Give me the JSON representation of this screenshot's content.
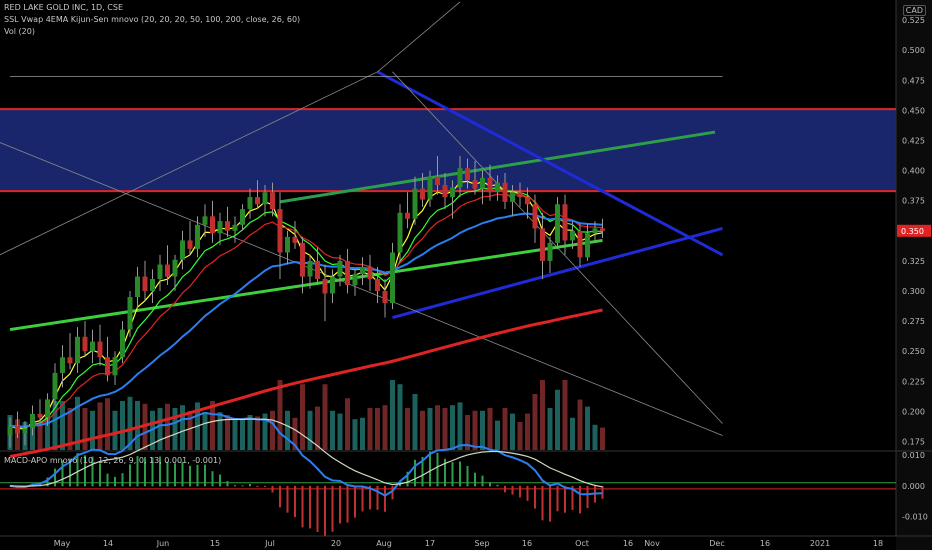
{
  "legend": {
    "line1": "RED LAKE GOLD INC, 1D, CSE",
    "line2": "SSL Vwap 4EMA Kijun-Sen mnovo (20, 20, 20, 50, 100, 200, close, 26, 60)",
    "line3": "Vol (20)",
    "macd": "MACD-APO mnovo (10, 12, 26, 9, 0, 13, 0.001, -0.001)"
  },
  "currency": "CAD",
  "chart_data": {
    "type": "candlestick",
    "price_axis": {
      "ticks": [
        "0.525",
        "0.500",
        "0.475",
        "0.450",
        "0.425",
        "0.400",
        "0.375",
        "0.350",
        "0.325",
        "0.300",
        "0.275",
        "0.250",
        "0.225",
        "0.200",
        "0.175"
      ],
      "ylim": [
        0.168,
        0.535
      ],
      "last_price": "0.350",
      "last_price_color": "#e02424"
    },
    "macd_axis": {
      "ticks": [
        "0.010",
        "0.000",
        "-0.010"
      ],
      "ylim": [
        -0.015,
        0.011
      ]
    },
    "x_ticks": [
      "May",
      "14",
      "Jun",
      "15",
      "Jul",
      "20",
      "Aug",
      "17",
      "Sep",
      "16",
      "Oct",
      "16",
      "Nov",
      "Dec",
      "16",
      "2021",
      "18"
    ],
    "zones": [
      {
        "name": "supply-zone",
        "from": 0.383,
        "to": 0.451,
        "color": "#1c2a78"
      }
    ],
    "red_levels": [
      0.451,
      0.383
    ],
    "candles": [
      {
        "o": 0.18,
        "h": 0.195,
        "l": 0.17,
        "c": 0.188
      },
      {
        "o": 0.188,
        "h": 0.2,
        "l": 0.178,
        "c": 0.182
      },
      {
        "o": 0.182,
        "h": 0.192,
        "l": 0.172,
        "c": 0.186
      },
      {
        "o": 0.186,
        "h": 0.205,
        "l": 0.18,
        "c": 0.198
      },
      {
        "o": 0.198,
        "h": 0.21,
        "l": 0.19,
        "c": 0.195
      },
      {
        "o": 0.195,
        "h": 0.215,
        "l": 0.188,
        "c": 0.21
      },
      {
        "o": 0.21,
        "h": 0.24,
        "l": 0.205,
        "c": 0.232
      },
      {
        "o": 0.232,
        "h": 0.255,
        "l": 0.22,
        "c": 0.245
      },
      {
        "o": 0.245,
        "h": 0.265,
        "l": 0.235,
        "c": 0.24
      },
      {
        "o": 0.24,
        "h": 0.27,
        "l": 0.232,
        "c": 0.262
      },
      {
        "o": 0.262,
        "h": 0.275,
        "l": 0.245,
        "c": 0.25
      },
      {
        "o": 0.25,
        "h": 0.268,
        "l": 0.24,
        "c": 0.258
      },
      {
        "o": 0.258,
        "h": 0.272,
        "l": 0.238,
        "c": 0.245
      },
      {
        "o": 0.245,
        "h": 0.262,
        "l": 0.225,
        "c": 0.23
      },
      {
        "o": 0.23,
        "h": 0.25,
        "l": 0.222,
        "c": 0.245
      },
      {
        "o": 0.245,
        "h": 0.275,
        "l": 0.24,
        "c": 0.268
      },
      {
        "o": 0.268,
        "h": 0.3,
        "l": 0.262,
        "c": 0.295
      },
      {
        "o": 0.295,
        "h": 0.32,
        "l": 0.285,
        "c": 0.312
      },
      {
        "o": 0.312,
        "h": 0.325,
        "l": 0.292,
        "c": 0.3
      },
      {
        "o": 0.3,
        "h": 0.318,
        "l": 0.29,
        "c": 0.31
      },
      {
        "o": 0.31,
        "h": 0.33,
        "l": 0.3,
        "c": 0.322
      },
      {
        "o": 0.322,
        "h": 0.338,
        "l": 0.305,
        "c": 0.312
      },
      {
        "o": 0.312,
        "h": 0.33,
        "l": 0.3,
        "c": 0.326
      },
      {
        "o": 0.326,
        "h": 0.35,
        "l": 0.318,
        "c": 0.342
      },
      {
        "o": 0.342,
        "h": 0.358,
        "l": 0.33,
        "c": 0.335
      },
      {
        "o": 0.335,
        "h": 0.362,
        "l": 0.328,
        "c": 0.355
      },
      {
        "o": 0.355,
        "h": 0.372,
        "l": 0.345,
        "c": 0.362
      },
      {
        "o": 0.362,
        "h": 0.375,
        "l": 0.34,
        "c": 0.348
      },
      {
        "o": 0.348,
        "h": 0.365,
        "l": 0.338,
        "c": 0.358
      },
      {
        "o": 0.358,
        "h": 0.37,
        "l": 0.345,
        "c": 0.35
      },
      {
        "o": 0.35,
        "h": 0.362,
        "l": 0.34,
        "c": 0.355
      },
      {
        "o": 0.355,
        "h": 0.372,
        "l": 0.35,
        "c": 0.368
      },
      {
        "o": 0.368,
        "h": 0.385,
        "l": 0.36,
        "c": 0.378
      },
      {
        "o": 0.378,
        "h": 0.392,
        "l": 0.368,
        "c": 0.372
      },
      {
        "o": 0.372,
        "h": 0.388,
        "l": 0.362,
        "c": 0.382
      },
      {
        "o": 0.382,
        "h": 0.39,
        "l": 0.362,
        "c": 0.368
      },
      {
        "o": 0.368,
        "h": 0.382,
        "l": 0.31,
        "c": 0.332
      },
      {
        "o": 0.332,
        "h": 0.35,
        "l": 0.322,
        "c": 0.345
      },
      {
        "o": 0.345,
        "h": 0.358,
        "l": 0.335,
        "c": 0.34
      },
      {
        "o": 0.34,
        "h": 0.345,
        "l": 0.298,
        "c": 0.312
      },
      {
        "o": 0.312,
        "h": 0.33,
        "l": 0.302,
        "c": 0.325
      },
      {
        "o": 0.325,
        "h": 0.336,
        "l": 0.305,
        "c": 0.31
      },
      {
        "o": 0.31,
        "h": 0.322,
        "l": 0.275,
        "c": 0.298
      },
      {
        "o": 0.298,
        "h": 0.318,
        "l": 0.29,
        "c": 0.312
      },
      {
        "o": 0.312,
        "h": 0.33,
        "l": 0.304,
        "c": 0.325
      },
      {
        "o": 0.325,
        "h": 0.335,
        "l": 0.298,
        "c": 0.305
      },
      {
        "o": 0.305,
        "h": 0.318,
        "l": 0.296,
        "c": 0.314
      },
      {
        "o": 0.314,
        "h": 0.328,
        "l": 0.305,
        "c": 0.32
      },
      {
        "o": 0.32,
        "h": 0.33,
        "l": 0.3,
        "c": 0.31
      },
      {
        "o": 0.31,
        "h": 0.32,
        "l": 0.29,
        "c": 0.3
      },
      {
        "o": 0.3,
        "h": 0.31,
        "l": 0.278,
        "c": 0.29
      },
      {
        "o": 0.29,
        "h": 0.34,
        "l": 0.285,
        "c": 0.332
      },
      {
        "o": 0.332,
        "h": 0.372,
        "l": 0.325,
        "c": 0.365
      },
      {
        "o": 0.365,
        "h": 0.382,
        "l": 0.352,
        "c": 0.36
      },
      {
        "o": 0.36,
        "h": 0.395,
        "l": 0.355,
        "c": 0.385
      },
      {
        "o": 0.385,
        "h": 0.398,
        "l": 0.37,
        "c": 0.376
      },
      {
        "o": 0.376,
        "h": 0.4,
        "l": 0.37,
        "c": 0.395
      },
      {
        "o": 0.395,
        "h": 0.412,
        "l": 0.38,
        "c": 0.388
      },
      {
        "o": 0.388,
        "h": 0.398,
        "l": 0.368,
        "c": 0.378
      },
      {
        "o": 0.378,
        "h": 0.392,
        "l": 0.36,
        "c": 0.386
      },
      {
        "o": 0.386,
        "h": 0.412,
        "l": 0.378,
        "c": 0.402
      },
      {
        "o": 0.402,
        "h": 0.41,
        "l": 0.385,
        "c": 0.392
      },
      {
        "o": 0.392,
        "h": 0.408,
        "l": 0.38,
        "c": 0.385
      },
      {
        "o": 0.385,
        "h": 0.4,
        "l": 0.372,
        "c": 0.394
      },
      {
        "o": 0.394,
        "h": 0.405,
        "l": 0.375,
        "c": 0.382
      },
      {
        "o": 0.382,
        "h": 0.396,
        "l": 0.375,
        "c": 0.39
      },
      {
        "o": 0.39,
        "h": 0.398,
        "l": 0.368,
        "c": 0.374
      },
      {
        "o": 0.374,
        "h": 0.388,
        "l": 0.362,
        "c": 0.382
      },
      {
        "o": 0.382,
        "h": 0.39,
        "l": 0.37,
        "c": 0.378
      },
      {
        "o": 0.378,
        "h": 0.386,
        "l": 0.36,
        "c": 0.372
      },
      {
        "o": 0.372,
        "h": 0.38,
        "l": 0.34,
        "c": 0.352
      },
      {
        "o": 0.352,
        "h": 0.365,
        "l": 0.31,
        "c": 0.325
      },
      {
        "o": 0.325,
        "h": 0.345,
        "l": 0.315,
        "c": 0.34
      },
      {
        "o": 0.34,
        "h": 0.378,
        "l": 0.335,
        "c": 0.372
      },
      {
        "o": 0.372,
        "h": 0.38,
        "l": 0.33,
        "c": 0.342
      },
      {
        "o": 0.342,
        "h": 0.358,
        "l": 0.335,
        "c": 0.35
      },
      {
        "o": 0.35,
        "h": 0.356,
        "l": 0.32,
        "c": 0.328
      },
      {
        "o": 0.328,
        "h": 0.356,
        "l": 0.325,
        "c": 0.348
      },
      {
        "o": 0.348,
        "h": 0.358,
        "l": 0.34,
        "c": 0.352
      },
      {
        "o": 0.352,
        "h": 0.36,
        "l": 0.344,
        "c": 0.35
      }
    ],
    "overlay_lines": [
      {
        "name": "green-trendline",
        "color": "#3ecf3e",
        "points": [
          [
            0,
            0.268
          ],
          [
            79,
            0.342
          ]
        ]
      },
      {
        "name": "green-trendline-upper",
        "color": "#2e9e4a",
        "points": [
          [
            36,
            0.374
          ],
          [
            94,
            0.432
          ]
        ]
      },
      {
        "name": "blue-descending-trendline",
        "color": "#1f2bd8",
        "points": [
          [
            49,
            0.482
          ],
          [
            95,
            0.33
          ]
        ]
      },
      {
        "name": "blue-ascending-trendline",
        "color": "#1f2bd8",
        "points": [
          [
            51,
            0.278
          ],
          [
            95,
            0.352
          ]
        ]
      },
      {
        "name": "grey-diagonal-1",
        "color": "#8a8a8a",
        "points": [
          [
            -8,
            0.31
          ],
          [
            49,
            0.482
          ],
          [
            60,
            0.54
          ]
        ]
      },
      {
        "name": "grey-diagonal-2",
        "color": "#8a8a8a",
        "points": [
          [
            -2,
            0.425
          ],
          [
            95,
            0.18
          ]
        ]
      },
      {
        "name": "grey-diagonal-3",
        "color": "#8a8a8a",
        "points": [
          [
            51,
            0.482
          ],
          [
            95,
            0.19
          ]
        ]
      },
      {
        "name": "grey-level-475",
        "color": "#9a9a9a",
        "points": [
          [
            0,
            0.478
          ],
          [
            95,
            0.478
          ]
        ]
      }
    ]
  }
}
